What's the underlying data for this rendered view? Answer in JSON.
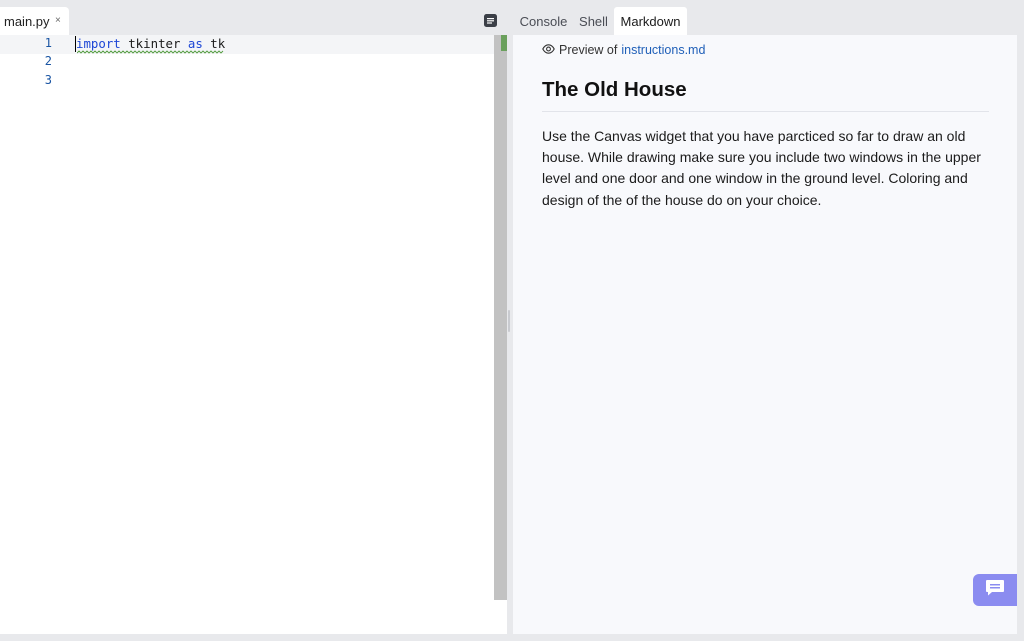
{
  "editor": {
    "tab": {
      "label": "main.py",
      "close": "×"
    },
    "toggle_icon": "panel-toggle-icon",
    "lines": [
      {
        "number": "1",
        "keyword1": "import",
        "text1": " tkinter ",
        "keyword2": "as",
        "text2": " tk"
      },
      {
        "number": "2"
      },
      {
        "number": "3"
      }
    ]
  },
  "right_tabs": [
    {
      "label": "Console",
      "active": false
    },
    {
      "label": "Shell",
      "active": false
    },
    {
      "label": "Markdown",
      "active": true
    }
  ],
  "preview": {
    "prefix": "Preview of",
    "file": "instructions.md",
    "title": "The Old House",
    "body": "Use the Canvas widget that you have parcticed so far to draw an old house. While drawing make sure you include two windows in the upper level and one door and one window in the ground level. Coloring and design of the of the house do on your choice."
  },
  "colors": {
    "keyword": "#1e47d6",
    "line_number": "#1a55a3",
    "link": "#1f5fb8",
    "chat_button": "#8b8cf0",
    "scroll_marker": "#6aa05c"
  },
  "icons": {
    "preview": "eye-icon",
    "chat": "chat-icon"
  }
}
